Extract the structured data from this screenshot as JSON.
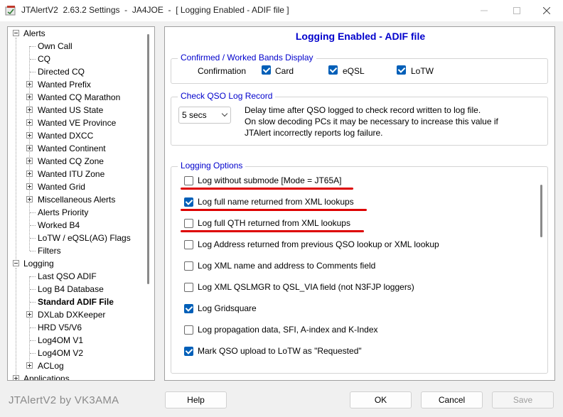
{
  "window": {
    "title": "JTAlertV2  2.63.2 Settings  -  JA4JOE  -  [ Logging Enabled - ADIF file ]"
  },
  "tree": {
    "items": [
      {
        "label": "Alerts",
        "expander": "minus"
      },
      {
        "label": "Own Call"
      },
      {
        "label": "CQ"
      },
      {
        "label": "Directed CQ"
      },
      {
        "label": "Wanted Prefix",
        "expander": "plus"
      },
      {
        "label": "Wanted CQ Marathon",
        "expander": "plus"
      },
      {
        "label": "Wanted US State",
        "expander": "plus"
      },
      {
        "label": "Wanted VE Province",
        "expander": "plus"
      },
      {
        "label": "Wanted DXCC",
        "expander": "plus"
      },
      {
        "label": "Wanted Continent",
        "expander": "plus"
      },
      {
        "label": "Wanted CQ Zone",
        "expander": "plus"
      },
      {
        "label": "Wanted ITU Zone",
        "expander": "plus"
      },
      {
        "label": "Wanted Grid",
        "expander": "plus"
      },
      {
        "label": "Miscellaneous Alerts",
        "expander": "plus"
      },
      {
        "label": "Alerts Priority"
      },
      {
        "label": "Worked B4"
      },
      {
        "label": "LoTW / eQSL(AG) Flags"
      },
      {
        "label": "Filters"
      },
      {
        "label": "Logging",
        "expander": "minus"
      },
      {
        "label": "Last QSO ADIF"
      },
      {
        "label": "Log B4 Database"
      },
      {
        "label": "Standard ADIF File",
        "selected": true
      },
      {
        "label": "DXLab DXKeeper",
        "expander": "plus"
      },
      {
        "label": "HRD V5/V6"
      },
      {
        "label": "Log4OM V1"
      },
      {
        "label": "Log4OM V2"
      },
      {
        "label": "ACLog",
        "expander": "plus"
      },
      {
        "label": "Applications",
        "expander": "plus"
      }
    ]
  },
  "page": {
    "title": "Logging Enabled - ADIF file",
    "confirmed": {
      "legend": "Confirmed / Worked Bands Display",
      "label": "Confirmation",
      "options": [
        {
          "label": "Card",
          "checked": true
        },
        {
          "label": "eQSL",
          "checked": true
        },
        {
          "label": "LoTW",
          "checked": true
        }
      ]
    },
    "check_qso": {
      "legend": "Check QSO Log Record",
      "delay_value": "5 secs",
      "desc_line1": "Delay time after QSO logged to check record written to log file.",
      "desc_line2": "On slow decoding PCs it may be necessary to increase this value if",
      "desc_line3": "JTAlert incorrectly reports log failure."
    },
    "logging_options": {
      "legend": "Logging Options",
      "options": [
        {
          "label": "Log without submode [Mode = JT65A]",
          "checked": false,
          "underlined": true
        },
        {
          "label": "Log full name returned from XML lookups",
          "checked": true,
          "underlined": true
        },
        {
          "label": "Log full QTH returned from XML lookups",
          "checked": false,
          "underlined": true
        },
        {
          "label": "Log Address returned from previous QSO lookup or XML lookup",
          "checked": false
        },
        {
          "label": "Log XML name and address to Comments field",
          "checked": false
        },
        {
          "label": "Log XML QSLMGR to QSL_VIA field (not N3FJP loggers)",
          "checked": false
        },
        {
          "label": "Log Gridsquare",
          "checked": true
        },
        {
          "label": "Log propagation data, SFI, A-index and K-Index",
          "checked": false
        },
        {
          "label": "Mark QSO upload to LoTW as \"Requested\"",
          "checked": true
        }
      ]
    }
  },
  "footer": {
    "brand": "JTAlertV2 by VK3AMA",
    "help": "Help",
    "ok": "OK",
    "cancel": "Cancel",
    "save": "Save"
  },
  "colors": {
    "accent": "#0000cc",
    "checkbox": "#005fb8",
    "annotation": "#dd0000"
  },
  "icons": [
    "app-icon",
    "minimize-icon",
    "maximize-icon",
    "close-icon",
    "chevron-down-icon"
  ]
}
